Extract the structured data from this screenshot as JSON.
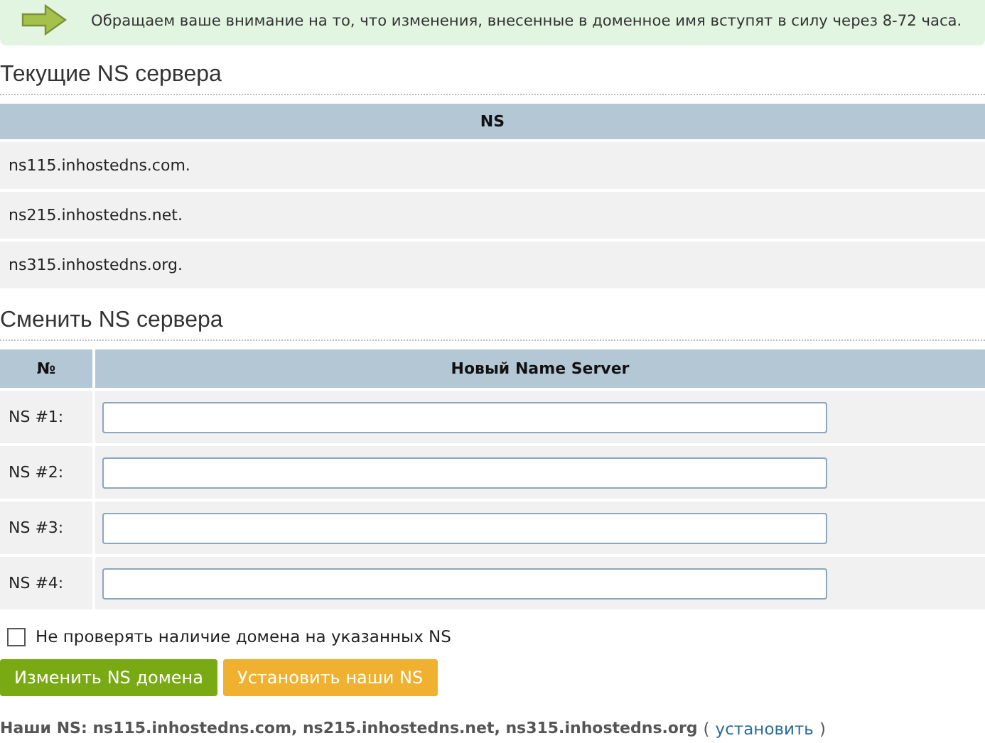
{
  "notice": {
    "text": "Обращаем ваше внимание на то, что изменения, внесенные в доменное имя вступят в силу через 8-72 часа."
  },
  "current": {
    "title": "Текущие NS сервера",
    "column": "NS",
    "rows": [
      {
        "value": "ns115.inhostedns.com."
      },
      {
        "value": "ns215.inhostedns.net."
      },
      {
        "value": "ns315.inhostedns.org."
      }
    ]
  },
  "change": {
    "title": "Сменить NS сервера",
    "columns": [
      "№",
      "Новый Name Server"
    ],
    "rows": [
      {
        "label": "NS #1:"
      },
      {
        "label": "NS #2:"
      },
      {
        "label": "NS #3:"
      },
      {
        "label": "NS #4:"
      }
    ]
  },
  "skip_check": {
    "label": "Не проверять наличие домена на указанных NS",
    "checked": false
  },
  "buttons": [
    {
      "label": "Изменить NS домена",
      "kind": "primary"
    },
    {
      "label": "Установить наши NS",
      "kind": "secondary"
    }
  ],
  "footer": {
    "text": "Наши NS: ns115.inhostedns.com, ns215.inhostedns.net, ns315.inhostedns.org",
    "open": "(",
    "link": "установить",
    "close": ")"
  }
}
